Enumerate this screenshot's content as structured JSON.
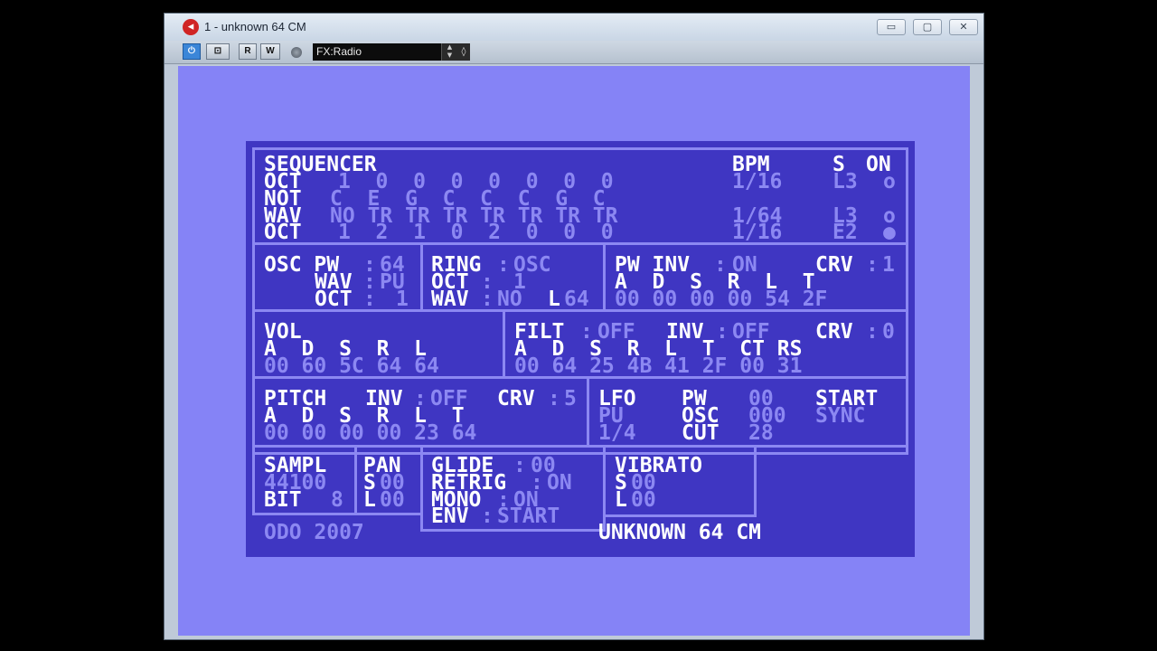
{
  "window": {
    "title": "1 - unknown 64 CM",
    "app_icon": "cubase-icon",
    "minimize": "▭",
    "maximize": "▢",
    "close": "✕"
  },
  "toolbar": {
    "power": "⏻",
    "bypass": "⊡",
    "read": "R",
    "write": "W",
    "preset_name": "FX:Radio",
    "arrows": "▲\n▼",
    "menu": "◊"
  },
  "sequencer": {
    "title": "SEQUENCER",
    "bpm_label": "BPM",
    "s_label": "S",
    "on_label": "ON",
    "rows": [
      {
        "label": "OCT",
        "values": "1  0  0  0  0  0  0  0",
        "rate": "1/16",
        "slot": "L3",
        "mark": "o"
      },
      {
        "label": "NOT",
        "values": "C  E  G  C  C  C  G  C",
        "rate": "",
        "slot": "",
        "mark": ""
      },
      {
        "label": "WAV",
        "values": "NO TR TR TR TR TR TR TR",
        "rate": "1/64",
        "slot": "L3",
        "mark": "o"
      },
      {
        "label": "OCT",
        "values": "1  2  1  0  2  0  0  0",
        "rate": "1/16",
        "slot": "E2",
        "mark": "●"
      }
    ]
  },
  "osc": {
    "pw_label": "OSC PW",
    "pw_sep": ":",
    "pw_value": "64",
    "wav_label": "WAV",
    "wav_sep": ":",
    "wav_value": "PU",
    "oct_label": "OCT",
    "oct_sep": ":",
    "oct_value": "1"
  },
  "ring": {
    "label": "RING",
    "sep": ":",
    "value": "OSC",
    "oct_label": "OCT",
    "oct_sep": ":",
    "oct_value": "1",
    "wav_label": "WAV",
    "wav_sep": ":",
    "wav_value": "NO",
    "l_label": "L",
    "l_value": "64"
  },
  "pw_env": {
    "label": "PW INV",
    "sep": ":",
    "value": "ON",
    "crv_label": "CRV",
    "crv_sep": ":",
    "crv_value": "1",
    "headers": "A  D  S  R  L  T",
    "values": "00 00 00 00 54 2F"
  },
  "vol": {
    "label": "VOL",
    "headers": "A  D  S  R  L",
    "values": "00 60 5C 64 64"
  },
  "filt": {
    "label": "FILT",
    "sep": ":",
    "value": "OFF",
    "inv_label": "INV",
    "inv_sep": ":",
    "inv_value": "OFF",
    "crv_label": "CRV",
    "crv_sep": ":",
    "crv_value": "0",
    "headers": "A  D  S  R  L  T  CT RS",
    "values": "00 64 25 4B 41 2F 00 31"
  },
  "pitch": {
    "label": "PITCH",
    "inv_label": "INV",
    "inv_sep": ":",
    "inv_value": "OFF",
    "crv_label": "CRV",
    "crv_sep": ":",
    "crv_value": "5",
    "headers": "A  D  S  R  L  T",
    "values": "00 00 00 00 23 64"
  },
  "lfo": {
    "label": "LFO",
    "wave": "PU",
    "rate": "1/4",
    "pw_label": "PW",
    "pw_value": "00",
    "osc_label": "OSC",
    "osc_value": "000",
    "cut_label": "CUT",
    "cut_value": "28",
    "start_label": "START",
    "sync_value": "SYNC"
  },
  "sampl": {
    "label": "SAMPL",
    "rate": "44100",
    "bit_label": "BIT",
    "bit_value": "8"
  },
  "pan": {
    "label": "PAN",
    "s_label": "S",
    "s_value": "00",
    "l_label": "L",
    "l_value": "00"
  },
  "glide": {
    "label": "GLIDE",
    "sep": ":",
    "value": "00",
    "retrig_label": "RETRIG",
    "retrig_sep": ":",
    "retrig_value": "ON",
    "mono_label": "MONO",
    "mono_sep": ":",
    "mono_value": "ON",
    "env_label": "ENV",
    "env_sep": ":",
    "env_value": "START"
  },
  "vibrato": {
    "label": "VIBRATO",
    "s_label": "S",
    "s_value": "00",
    "l_label": "L",
    "l_value": "00"
  },
  "footer": {
    "credit": "ODO 2007",
    "name": "UNKNOWN 64 CM"
  }
}
